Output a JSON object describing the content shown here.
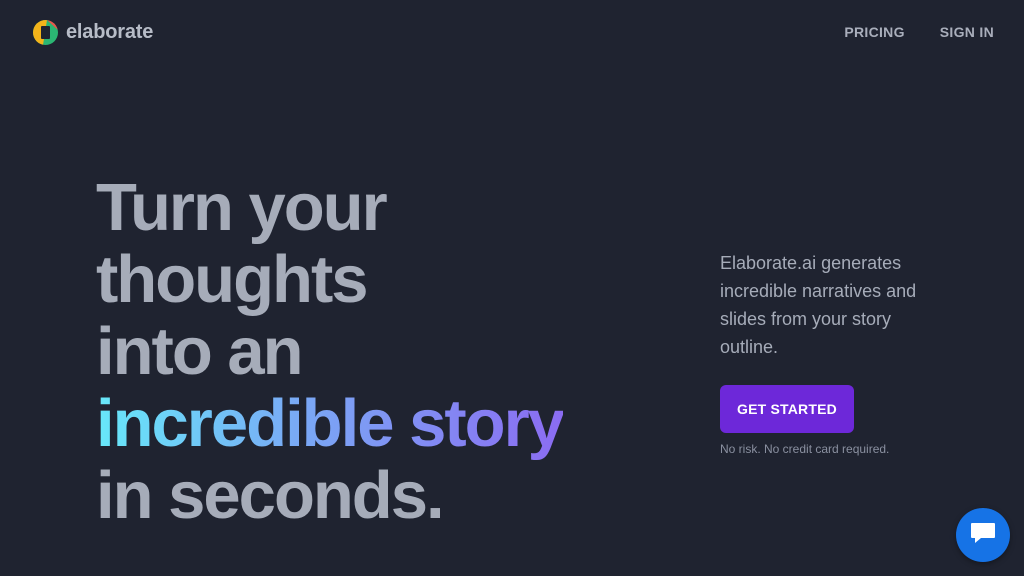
{
  "brand": {
    "name": "elaborate",
    "icon": "elaborate-logo-icon"
  },
  "nav": {
    "pricing": "PRICING",
    "sign_in": "SIGN IN"
  },
  "hero": {
    "line1": "Turn your",
    "line2": "thoughts",
    "line3": "into an",
    "highlight": "incredible story",
    "line5": "in seconds."
  },
  "side": {
    "description": "Elaborate.ai generates incredible narratives and slides from your story outline.",
    "cta_label": "GET STARTED",
    "note": "No risk. No credit card required."
  },
  "chat": {
    "icon": "chat-bubble-icon"
  },
  "colors": {
    "background": "#1f2330",
    "accent": "#6d28d9",
    "chat": "#1673e6",
    "gradient_start": "#67e8f9",
    "gradient_end": "#8b6cf2"
  }
}
